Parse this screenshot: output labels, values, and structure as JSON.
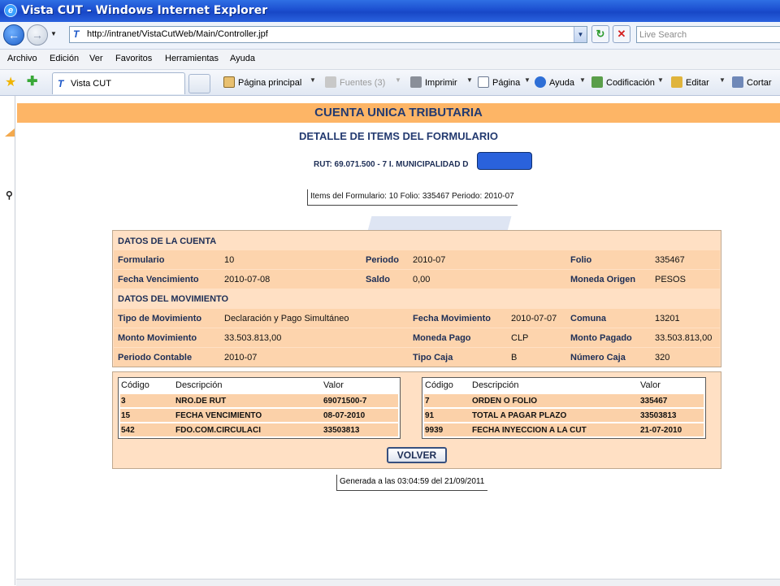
{
  "window": {
    "title": "Vista CUT - Windows Internet Explorer"
  },
  "address": {
    "url": "http://intranet/VistaCutWeb/Main/Controller.jpf"
  },
  "search": {
    "placeholder": "Live Search"
  },
  "menu": [
    "Archivo",
    "Edición",
    "Ver",
    "Favoritos",
    "Herramientas",
    "Ayuda"
  ],
  "tab": {
    "label": "Vista CUT"
  },
  "commands": {
    "home": "Página principal",
    "feeds": "Fuentes (3)",
    "print": "Imprimir",
    "page": "Página",
    "help": "Ayuda",
    "encoding": "Codificación",
    "edit": "Editar",
    "cut": "Cortar"
  },
  "header": {
    "banner": "CUENTA UNICA TRIBUTARIA",
    "subtitle": "DETALLE DE ITEMS DEL FORMULARIO",
    "rut": "RUT: 69.071.500 - 7 I. MUNICIPALIDAD D",
    "items_info": "Items del Formulario: 10 Folio: 335467 Periodo: 2010-07"
  },
  "cuenta": {
    "section": "DATOS DE LA CUENTA",
    "formulario_label": "Formulario",
    "formulario": "10",
    "periodo_label": "Periodo",
    "periodo": "2010-07",
    "folio_label": "Folio",
    "folio": "335467",
    "vencimiento_label": "Fecha Vencimiento",
    "vencimiento": "2010-07-08",
    "saldo_label": "Saldo",
    "saldo": "0,00",
    "moneda_origen_label": "Moneda Origen",
    "moneda_origen": "PESOS"
  },
  "movimiento": {
    "section": "DATOS DEL MOVIMIENTO",
    "tipo_label": "Tipo de Movimiento",
    "tipo": "Declaración y Pago Simultáneo",
    "fecha_label": "Fecha Movimiento",
    "fecha": "2010-07-07",
    "comuna_label": "Comuna",
    "comuna": "13201",
    "monto_label": "Monto Movimiento",
    "monto": "33.503.813,00",
    "moneda_pago_label": "Moneda Pago",
    "moneda_pago": "CLP",
    "monto_pagado_label": "Monto Pagado",
    "monto_pagado": "33.503.813,00",
    "periodo_contable_label": "Periodo Contable",
    "periodo_contable": "2010-07",
    "tipo_caja_label": "Tipo Caja",
    "tipo_caja": "B",
    "numero_caja_label": "Número Caja",
    "numero_caja": "320"
  },
  "items_left": {
    "headers": [
      "Código",
      "Descripción",
      "Valor"
    ],
    "rows": [
      [
        "3",
        "NRO.DE RUT",
        "69071500-7"
      ],
      [
        "15",
        "FECHA VENCIMIENTO",
        "08-07-2010"
      ],
      [
        "542",
        "FDO.COM.CIRCULACI",
        "33503813"
      ]
    ]
  },
  "items_right": {
    "headers": [
      "Código",
      "Descripción",
      "Valor"
    ],
    "rows": [
      [
        "7",
        "ORDEN O FOLIO",
        "335467"
      ],
      [
        "91",
        "TOTAL A PAGAR PLAZO",
        "33503813"
      ],
      [
        "9939",
        "FECHA INYECCION A LA CUT",
        "21-07-2010"
      ]
    ]
  },
  "actions": {
    "volver": "VOLVER"
  },
  "footer": {
    "generated": "Generada a las 03:04:59 del 21/09/2011"
  }
}
